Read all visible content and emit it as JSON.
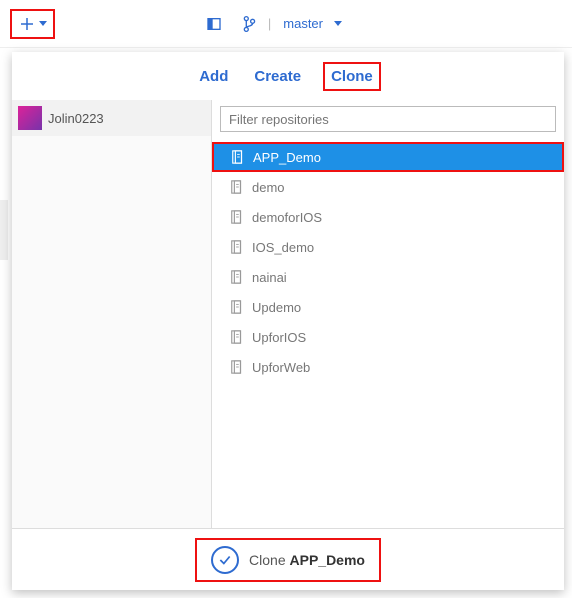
{
  "toolbar": {
    "branch_label": "master"
  },
  "tabs": {
    "add": "Add",
    "create": "Create",
    "clone": "Clone",
    "active": "clone"
  },
  "owner": {
    "name": "Jolin0223"
  },
  "filter": {
    "placeholder": "Filter repositories",
    "value": ""
  },
  "repos": [
    {
      "name": "APP_Demo",
      "selected": true,
      "highlight": true
    },
    {
      "name": "demo"
    },
    {
      "name": "demoforIOS"
    },
    {
      "name": "IOS_demo"
    },
    {
      "name": "nainai"
    },
    {
      "name": "Updemo"
    },
    {
      "name": "UpforIOS"
    },
    {
      "name": "UpforWeb"
    }
  ],
  "footer": {
    "action_prefix": "Clone ",
    "target": "APP_Demo"
  }
}
